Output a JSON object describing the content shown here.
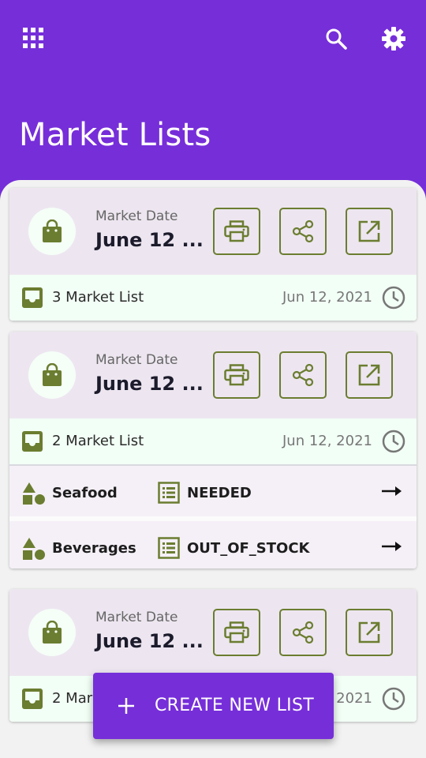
{
  "header": {
    "title": "Market Lists",
    "apps_icon": "apps-grid-icon",
    "search_icon": "search-icon",
    "settings_icon": "gear-icon",
    "background": "#762ed9"
  },
  "cards": [
    {
      "date_label": "Market Date",
      "date_value": "June 12 ...",
      "list_count": "3 Market List",
      "date": "Jun 12, 2021",
      "items": []
    },
    {
      "date_label": "Market Date",
      "date_value": "June 12 ...",
      "list_count": "2 Market List",
      "date": "Jun 12, 2021",
      "items": [
        {
          "category": "Seafood",
          "status": "NEEDED"
        },
        {
          "category": "Beverages",
          "status": "OUT_OF_STOCK"
        }
      ]
    },
    {
      "date_label": "Market Date",
      "date_value": "June 12 ...",
      "list_count": "2 Market List",
      "date": "Jun 12, 2021",
      "items": []
    }
  ],
  "fab": {
    "label": "CREATE NEW LIST",
    "icon": "plus-icon"
  },
  "colors": {
    "primary": "#762ed9",
    "accent_green": "#6b7d30",
    "card_top": "#ede6f0",
    "card_footer": "#f2fff6"
  }
}
